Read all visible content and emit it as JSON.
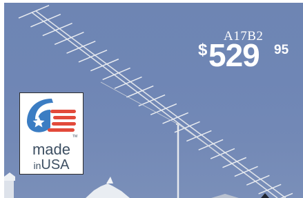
{
  "product": {
    "model": "A17B2",
    "price": {
      "symbol": "$",
      "dollars": "529",
      "cents": "95"
    }
  },
  "badge": {
    "line1": "made",
    "line2_small": "in",
    "line2_large": "USA",
    "icon": "usa-flag-icon",
    "trademark": "TM"
  },
  "colors": {
    "sky": "#6f86b5",
    "flag_blue": "#3b7dc3",
    "flag_red": "#e24a3b",
    "badge_text": "#3d4f62"
  }
}
